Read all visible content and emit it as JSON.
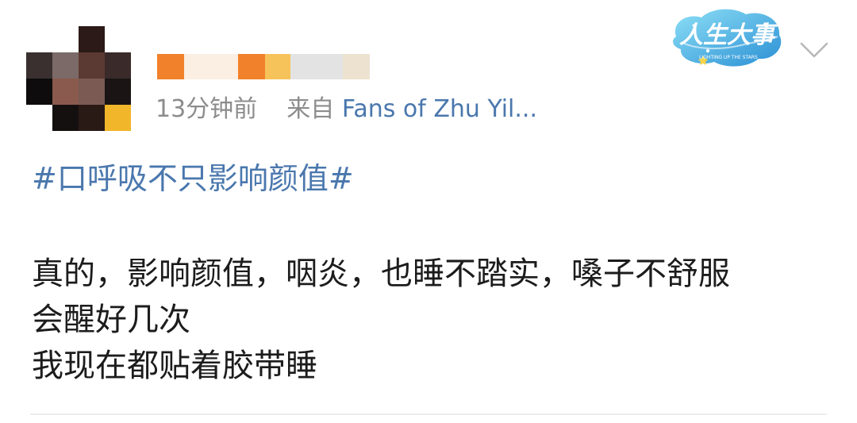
{
  "post": {
    "time": "13分钟前",
    "via_label": "来自",
    "source": "Fans of Zhu Yil...",
    "topic": "#口呼吸不只影响颜值#",
    "lines": [
      "真的，影响颜值，咽炎，也睡不踏实，嗓子不舒服",
      "会醒好几次",
      "我现在都贴着胶带睡"
    ]
  },
  "badge": {
    "text": "人生大事",
    "subtext": "LIGHTING UP THE STARS"
  },
  "icons": {
    "avatar": "avatar-pixelated",
    "more": "chevron-down-icon"
  },
  "colors": {
    "link": "#4a77ad",
    "meta": "#8c8c8c",
    "text": "#1c1c1c"
  }
}
